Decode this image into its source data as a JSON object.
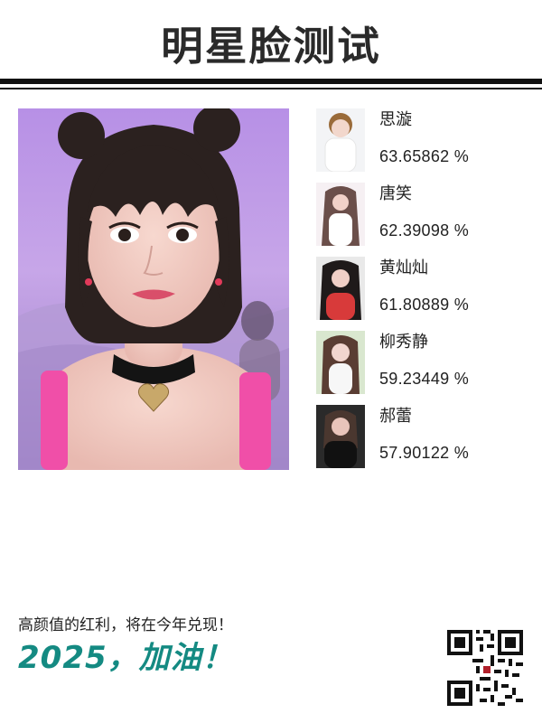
{
  "header": {
    "title": "明星脸测试"
  },
  "main_photo": {
    "kind": "portrait-photo"
  },
  "results": [
    {
      "name": "思漩",
      "percent": "63.65862 %"
    },
    {
      "name": "唐笑",
      "percent": "62.39098 %"
    },
    {
      "name": "黄灿灿",
      "percent": "61.80889 %"
    },
    {
      "name": "柳秀静",
      "percent": "59.23449 %"
    },
    {
      "name": "郝蕾",
      "percent": "57.90122 %"
    }
  ],
  "footer": {
    "tagline": "高颜值的红利，将在今年兑现！",
    "cheer": "2025，加油！"
  },
  "colors": {
    "accent": "#148a82",
    "title": "#2a2a2a",
    "rule": "#111111"
  }
}
